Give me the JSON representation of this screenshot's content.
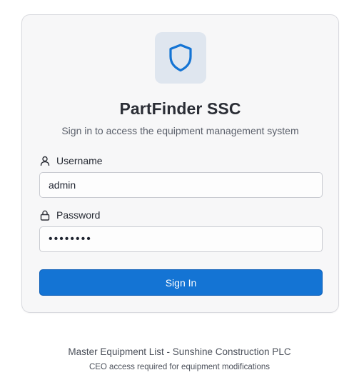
{
  "app": {
    "title": "PartFinder SSC",
    "subtitle": "Sign in to access the equipment management system",
    "logo_icon": "shield-icon",
    "accent_color": "#1474d4"
  },
  "form": {
    "username": {
      "label": "Username",
      "icon": "user-icon",
      "value": "admin"
    },
    "password": {
      "label": "Password",
      "icon": "lock-icon",
      "value": "••••••••"
    },
    "submit_label": "Sign In"
  },
  "footer": {
    "line1": "Master Equipment List - Sunshine Construction PLC",
    "line2": "CEO access required for equipment modifications"
  }
}
